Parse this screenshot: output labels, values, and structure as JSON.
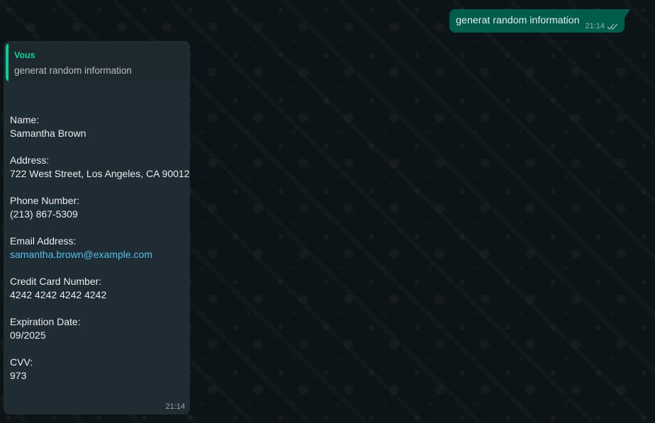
{
  "outgoing": {
    "text": "generat random information",
    "time": "21:14",
    "status_icon": "double-check-icon"
  },
  "incoming": {
    "quote": {
      "author": "Vous",
      "text": "generat random information"
    },
    "fields": [
      {
        "label": "Name:",
        "value": "Samantha Brown"
      },
      {
        "label": "Address:",
        "value": "722 West Street, Los Angeles, CA 90012"
      },
      {
        "label": "Phone Number:",
        "value": "(213) 867-5309"
      },
      {
        "label": "Email Address:",
        "value": "samantha.brown@example.com"
      },
      {
        "label": "Credit Card Number:",
        "value": "4242 4242 4242 4242"
      },
      {
        "label": "Expiration Date:",
        "value": "09/2025"
      },
      {
        "label": "CVV:",
        "value": "973"
      }
    ],
    "time": "21:14"
  },
  "colors": {
    "background": "#0d1418",
    "outgoing_bubble": "#005c4b",
    "incoming_bubble": "#202c33",
    "quote_accent": "#06cf9c",
    "link": "#53bdeb"
  }
}
